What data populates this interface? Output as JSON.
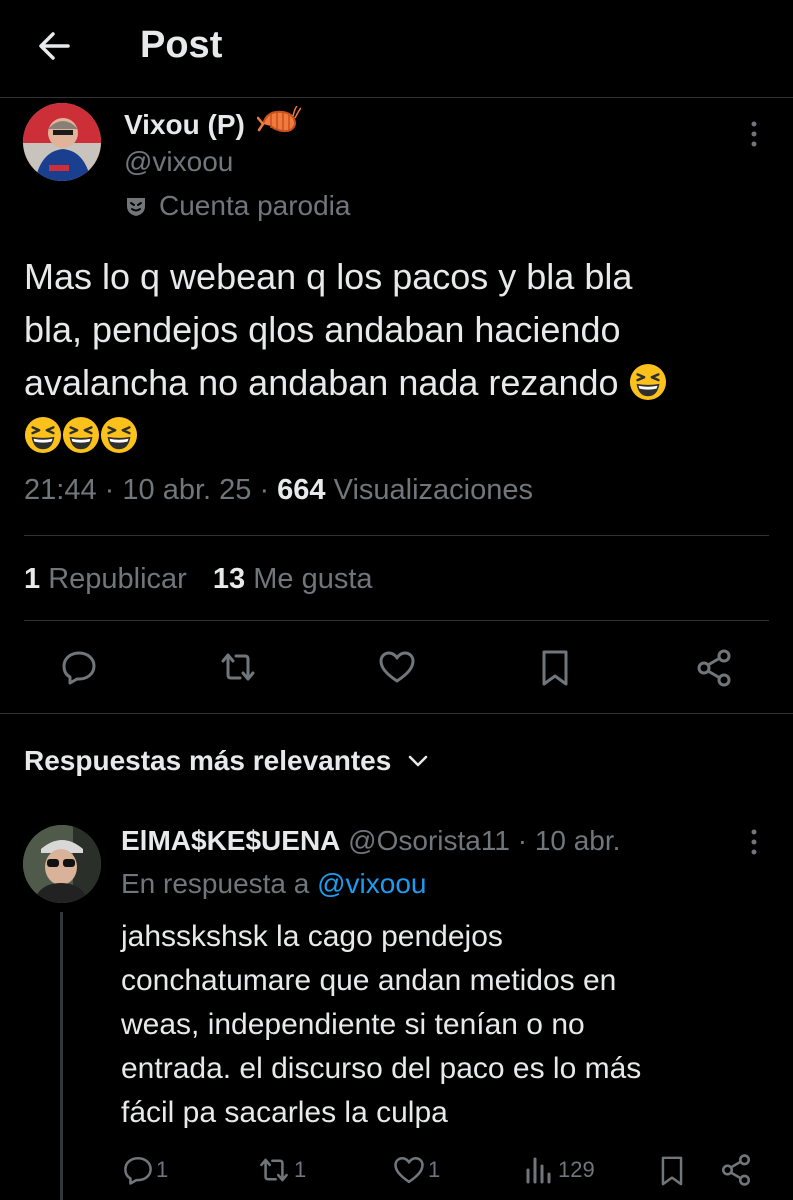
{
  "header": {
    "title": "Post"
  },
  "post": {
    "display_name": "Vixou (P)",
    "handle": "@vixoou",
    "badge": "Cuenta parodia",
    "text_line1": "Mas lo q webean q los pacos y bla bla",
    "text_line2": "bla, pendejos qlos andaban haciendo",
    "text_line3": "avalancha no andaban nada rezando",
    "time": "21:44",
    "date": "10 abr. 25",
    "views_count": "664",
    "views_label": "Visualizaciones",
    "reposts_count": "1",
    "reposts_label": "Republicar",
    "likes_count": "13",
    "likes_label": "Me gusta"
  },
  "replies_section": {
    "sort_label": "Respuestas más relevantes"
  },
  "reply": {
    "display_name": "ElMA$KE$UENA",
    "handle": "@Osorista11",
    "date": "10 abr.",
    "in_reply_prefix": "En respuesta a",
    "in_reply_handle": "@vixoou",
    "line1": "jahsskshsk la cago pendejos",
    "line2": "conchatumare que andan metidos en",
    "line3": "weas, independiente si tenían o no",
    "line4": "entrada. el discurso del paco es lo más",
    "line5": "fácil pa sacarles la culpa",
    "replies": "1",
    "reposts": "1",
    "likes": "1",
    "views": "129"
  },
  "colors": {
    "background": "#000000",
    "text": "#e7e9ea",
    "muted": "#71767b",
    "link": "#1d9bf0",
    "divider": "#2f3336"
  },
  "icons": [
    "back-arrow-icon",
    "shrimp-emoji",
    "more-icon",
    "parody-mask-icon",
    "grinning-squint-emoji",
    "reply-icon",
    "repost-icon",
    "like-icon",
    "bookmark-icon",
    "share-icon",
    "chevron-down-icon",
    "views-icon"
  ]
}
